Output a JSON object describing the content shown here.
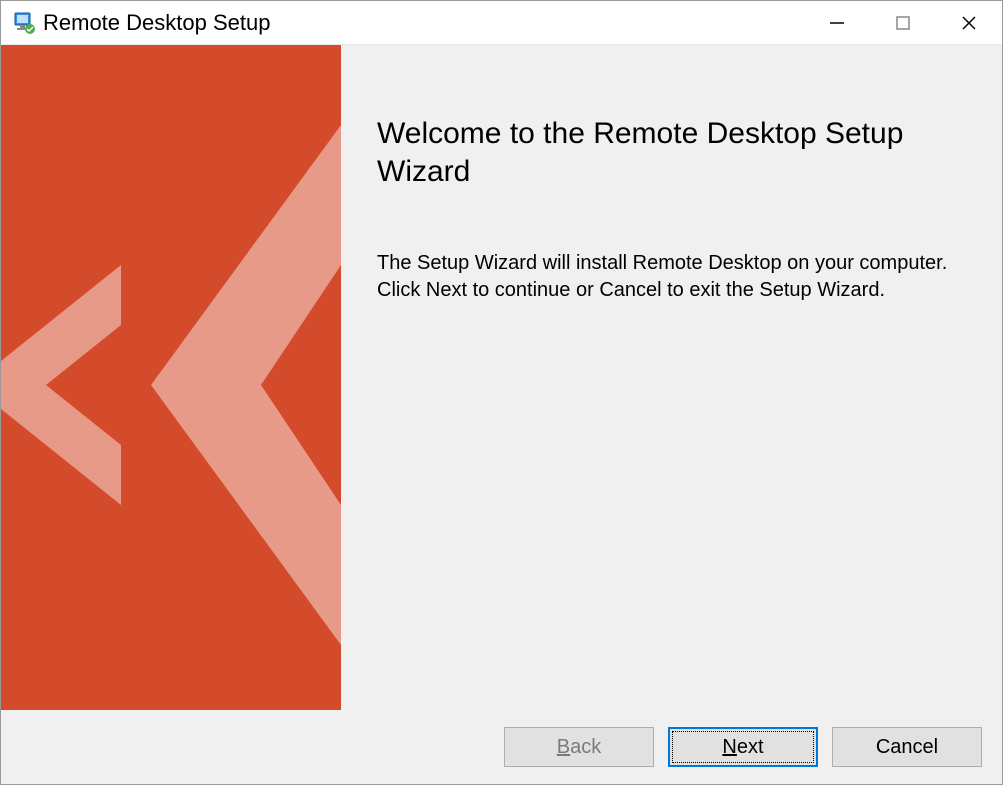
{
  "titlebar": {
    "title": "Remote Desktop Setup"
  },
  "content": {
    "heading": "Welcome to the Remote Desktop Setup Wizard",
    "body": "The Setup Wizard will install Remote Desktop on your computer. Click Next to continue or Cancel to exit the Setup Wizard."
  },
  "buttons": {
    "back": "Back",
    "next": "Next",
    "cancel": "Cancel"
  },
  "colors": {
    "banner_bg": "#d34b2a",
    "banner_overlay": "#e69a87"
  }
}
